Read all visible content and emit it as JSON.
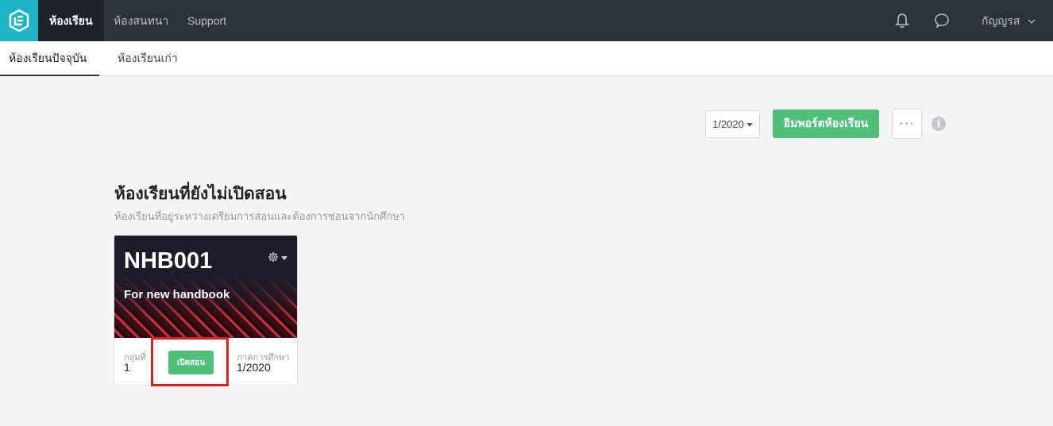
{
  "topnav": {
    "items": [
      {
        "label": "ห้องเรียน",
        "active": true
      },
      {
        "label": "ห้องสนทนา",
        "active": false
      },
      {
        "label": "Support",
        "active": false
      }
    ],
    "user_name": "กัญญรส",
    "icons": [
      "logo-icon",
      "bell-icon",
      "chat-icon",
      "chevron-down-icon"
    ]
  },
  "subtabs": [
    {
      "label": "ห้องเรียนปัจจุบัน",
      "active": true
    },
    {
      "label": "ห้องเรียนเก่า",
      "active": false
    }
  ],
  "toolbar": {
    "semester_value": "1/2020",
    "import_label": "อิมพอร์ตห้องเรียน",
    "more_label": "···",
    "info_label": "i"
  },
  "section": {
    "title": "ห้องเรียนที่ยังไม่เปิดสอน",
    "subtitle": "ห้องเรียนที่อยู่ระหว่างเตรียมการสอนและต้องการซ่อนจากนักศึกษา"
  },
  "card": {
    "code": "NHB001",
    "name": "For new handbook",
    "group_label": "กลุ่มที่",
    "group_value": "1",
    "open_label": "เปิดสอน",
    "semester_label": "ภาคการศึกษา",
    "semester_value": "1/2020"
  },
  "colors": {
    "topbar": "#2d333d",
    "logo_bg": "#1fb5c4",
    "accent_green": "#4fbf7a",
    "highlight_red": "#e02020"
  }
}
